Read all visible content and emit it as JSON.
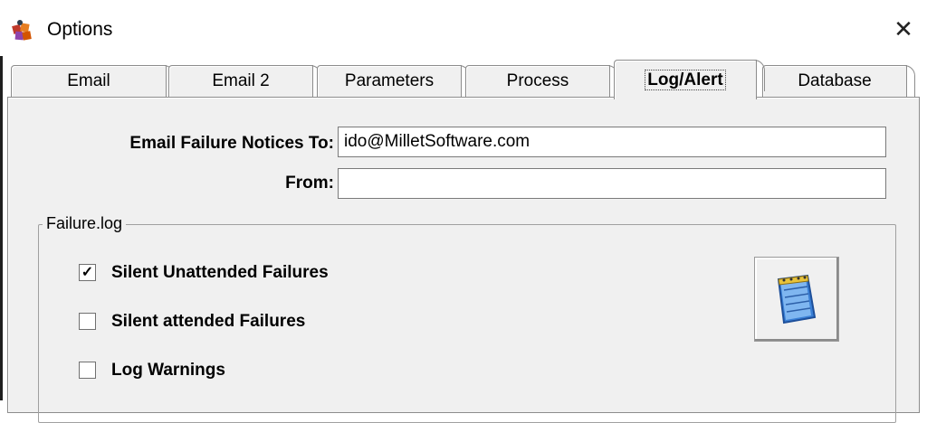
{
  "window": {
    "title": "Options",
    "close_glyph": "✕",
    "app_icon": "options-app-icon"
  },
  "tabs": [
    {
      "label": "Email",
      "active": false
    },
    {
      "label": "Email 2",
      "active": false
    },
    {
      "label": "Parameters",
      "active": false
    },
    {
      "label": "Process",
      "active": false
    },
    {
      "label": "Log/Alert",
      "active": true
    },
    {
      "label": "Database",
      "active": false
    }
  ],
  "form": {
    "failure_to_label": "Email Failure Notices To:",
    "failure_to_value": "ido@MilletSoftware.com",
    "from_label": "From:",
    "from_value": ""
  },
  "failure_log": {
    "legend": "Failure.log",
    "options": [
      {
        "label": "Silent Unattended Failures",
        "checked": true
      },
      {
        "label": "Silent attended Failures",
        "checked": false
      },
      {
        "label": "Log Warnings",
        "checked": false
      }
    ],
    "check_glyph": "✓",
    "notepad_icon": "notepad-icon"
  },
  "colors": {
    "panel_bg": "#f0f0f0",
    "border": "#8c8c8c",
    "notepad_blue": "#3a7fd5"
  }
}
